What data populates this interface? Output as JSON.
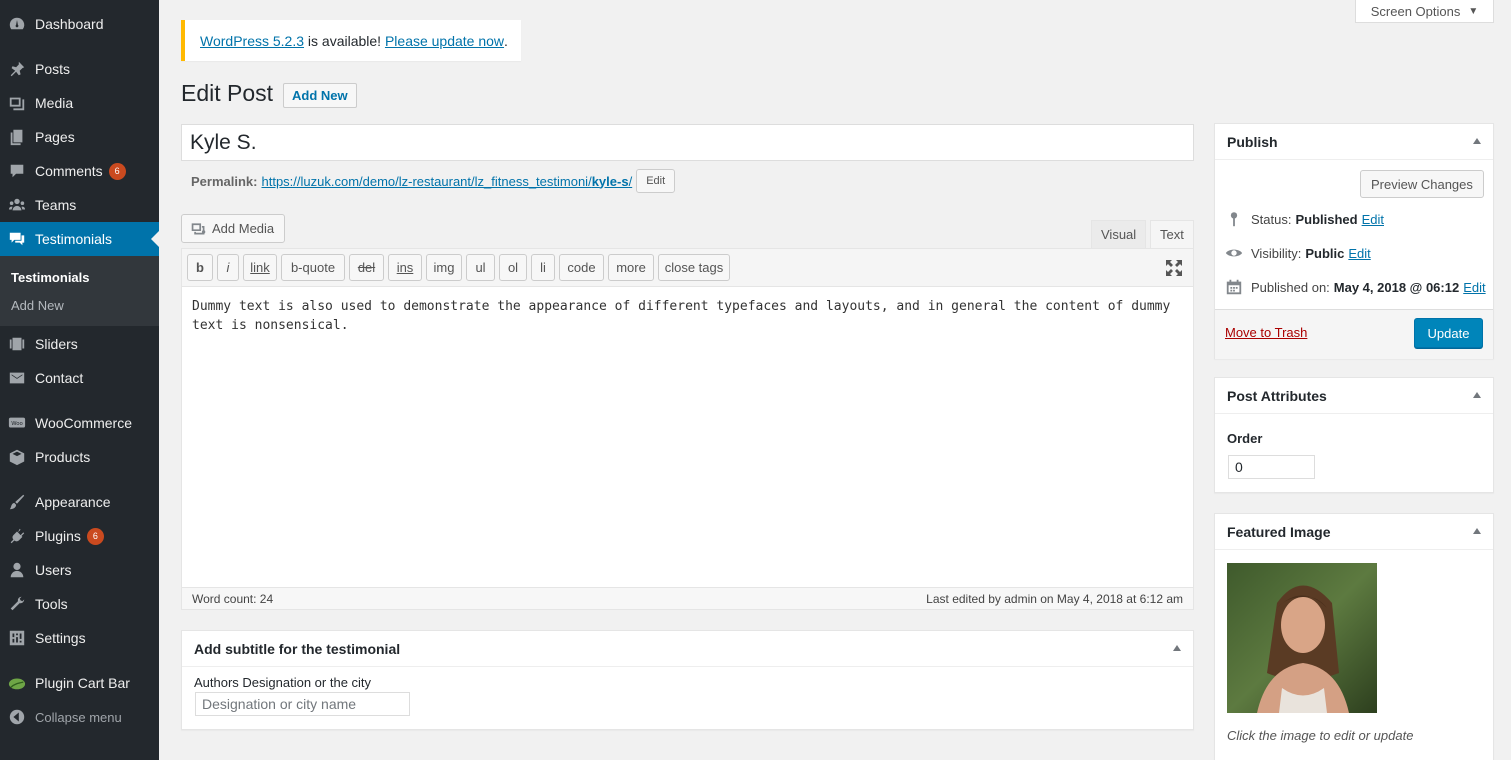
{
  "sidebar": {
    "items": [
      {
        "label": "Dashboard",
        "icon": "dashboard-icon"
      },
      {
        "label": "Posts",
        "icon": "pin-icon"
      },
      {
        "label": "Media",
        "icon": "media-icon"
      },
      {
        "label": "Pages",
        "icon": "pages-icon"
      },
      {
        "label": "Comments",
        "icon": "comments-icon",
        "badge": "6"
      },
      {
        "label": "Teams",
        "icon": "groups-icon"
      },
      {
        "label": "Testimonials",
        "icon": "testimonial-icon"
      },
      {
        "label": "Sliders",
        "icon": "slides-icon"
      },
      {
        "label": "Contact",
        "icon": "mail-icon"
      },
      {
        "label": "WooCommerce",
        "icon": "woocommerce-icon"
      },
      {
        "label": "Products",
        "icon": "archive-icon"
      },
      {
        "label": "Appearance",
        "icon": "brush-icon"
      },
      {
        "label": "Plugins",
        "icon": "plugin-icon",
        "badge": "6"
      },
      {
        "label": "Users",
        "icon": "user-icon"
      },
      {
        "label": "Tools",
        "icon": "wrench-icon"
      },
      {
        "label": "Settings",
        "icon": "settings-icon"
      },
      {
        "label": "Plugin Cart Bar",
        "icon": "leaf-icon"
      }
    ],
    "submenu": [
      "Testimonials",
      "Add New"
    ],
    "collapse_label": "Collapse menu"
  },
  "screen_options": "Screen Options",
  "notice": {
    "version_link": "WordPress 5.2.3",
    "middle": " is available! ",
    "update_link": "Please update now",
    "end": "."
  },
  "header": {
    "title": "Edit Post",
    "add_new": "Add New"
  },
  "post": {
    "title": "Kyle S.",
    "permalink_label": "Permalink:",
    "permalink_base": "https://luzuk.com/demo/lz-restaurant/lz_fitness_testimoni/",
    "permalink_slug": "kyle-s",
    "permalink_end": "/",
    "edit_label": "Edit"
  },
  "editor": {
    "add_media": "Add Media",
    "tabs": [
      "Visual",
      "Text"
    ],
    "quicktags": [
      "b",
      "i",
      "link",
      "b-quote",
      "del",
      "ins",
      "img",
      "ul",
      "ol",
      "li",
      "code",
      "more",
      "close tags"
    ],
    "content": "Dummy text is also used to demonstrate the appearance of different typefaces and layouts, and in general the content of dummy text is nonsensical.",
    "word_count": "Word count: 24",
    "last_edited": "Last edited by admin on May 4, 2018 at 6:12 am"
  },
  "subtitle_box": {
    "title": "Add subtitle for the testimonial",
    "label": "Authors Designation or the city",
    "placeholder": "Designation or city name"
  },
  "publish": {
    "title": "Publish",
    "preview": "Preview Changes",
    "status_label": "Status:",
    "status_value": "Published",
    "visibility_label": "Visibility:",
    "visibility_value": "Public",
    "published_label": "Published on:",
    "published_value": "May 4, 2018 @ 06:12",
    "edit": "Edit",
    "trash": "Move to Trash",
    "update": "Update"
  },
  "attributes": {
    "title": "Post Attributes",
    "order_label": "Order",
    "order_value": "0"
  },
  "featured": {
    "title": "Featured Image",
    "caption": "Click the image to edit or update"
  },
  "colors": {
    "sidebar_bg": "#23282d",
    "active": "#0073aa",
    "primary_button": "#0085ba",
    "notice_border": "#ffb900",
    "badge": "#ca4a1f",
    "trash": "#a00"
  }
}
